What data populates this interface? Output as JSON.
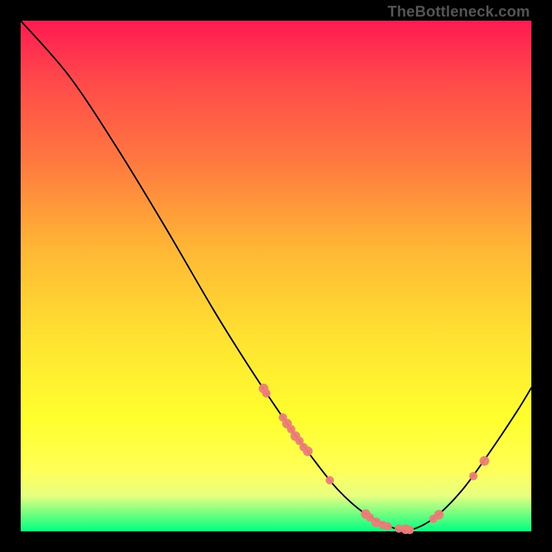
{
  "watermark": "TheBottleneck.com",
  "colors": {
    "dot": "#ed7c78",
    "curve": "#000000"
  },
  "chart_data": {
    "type": "line",
    "title": "",
    "xlabel": "",
    "ylabel": "",
    "xlim": [
      0,
      740
    ],
    "ylim_note": "y maps top→bottom in SVG coords (0 at top of plot, 740 at bottom)",
    "curve_points": [
      {
        "x": 0,
        "y": 0
      },
      {
        "x": 70,
        "y": 80
      },
      {
        "x": 140,
        "y": 185
      },
      {
        "x": 210,
        "y": 300
      },
      {
        "x": 280,
        "y": 420
      },
      {
        "x": 330,
        "y": 500
      },
      {
        "x": 380,
        "y": 575
      },
      {
        "x": 420,
        "y": 630
      },
      {
        "x": 460,
        "y": 680
      },
      {
        "x": 500,
        "y": 715
      },
      {
        "x": 540,
        "y": 735
      },
      {
        "x": 565,
        "y": 738
      },
      {
        "x": 600,
        "y": 720
      },
      {
        "x": 640,
        "y": 680
      },
      {
        "x": 680,
        "y": 625
      },
      {
        "x": 720,
        "y": 565
      },
      {
        "x": 740,
        "y": 532
      }
    ],
    "scatter_points": [
      {
        "x": 352,
        "y": 533,
        "r": 7
      },
      {
        "x": 356,
        "y": 540,
        "r": 6
      },
      {
        "x": 380,
        "y": 575,
        "r": 6
      },
      {
        "x": 386,
        "y": 584,
        "r": 7
      },
      {
        "x": 392,
        "y": 592,
        "r": 6
      },
      {
        "x": 398,
        "y": 602,
        "r": 7
      },
      {
        "x": 404,
        "y": 609,
        "r": 6
      },
      {
        "x": 410,
        "y": 618,
        "r": 6
      },
      {
        "x": 416,
        "y": 624,
        "r": 7
      },
      {
        "x": 448,
        "y": 666,
        "r": 6
      },
      {
        "x": 500,
        "y": 715,
        "r": 7
      },
      {
        "x": 506,
        "y": 720,
        "r": 6
      },
      {
        "x": 515,
        "y": 727,
        "r": 7
      },
      {
        "x": 525,
        "y": 731,
        "r": 6
      },
      {
        "x": 532,
        "y": 733,
        "r": 6
      },
      {
        "x": 548,
        "y": 736,
        "r": 6
      },
      {
        "x": 558,
        "y": 737,
        "r": 7
      },
      {
        "x": 564,
        "y": 738,
        "r": 6
      },
      {
        "x": 598,
        "y": 722,
        "r": 6
      },
      {
        "x": 606,
        "y": 716,
        "r": 7
      },
      {
        "x": 656,
        "y": 660,
        "r": 6
      },
      {
        "x": 672,
        "y": 638,
        "r": 7
      }
    ]
  }
}
